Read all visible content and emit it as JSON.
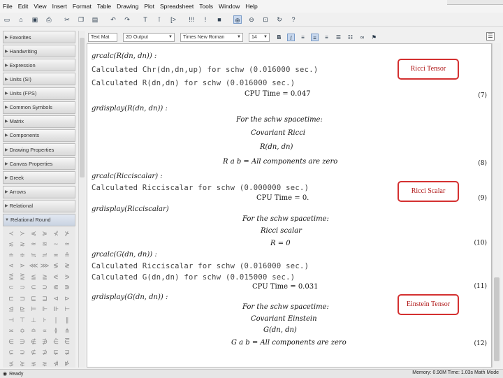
{
  "menu": [
    "File",
    "Edit",
    "View",
    "Insert",
    "Format",
    "Table",
    "Drawing",
    "Plot",
    "Spreadsheet",
    "Tools",
    "Window",
    "Help"
  ],
  "format_bar": {
    "style": "Text Mat",
    "font_size_label": "2D Output",
    "font": "Times New Roman",
    "size": "14",
    "bold": "B",
    "italic": "I"
  },
  "palettes": [
    "Favorites",
    "Handwriting",
    "Expression",
    "Units (SI)",
    "Units (FPS)",
    "Common Symbols",
    "Matrix",
    "Components",
    "Drawing Properties",
    "Canvas Properties",
    "Greek",
    "Arrows",
    "Relational",
    "Relational Round"
  ],
  "document": {
    "in1": "grcalc(R(dn, dn)) :",
    "out1a": "Calculated Chr(dn,dn,up) for schw (0.016000 sec.)",
    "out1b": "Calculated R(dn,dn) for schw (0.016000 sec.)",
    "cpu1": "CPU Time = 0.047",
    "eq7": "(7)",
    "in2": "grdisplay(R(dn, dn)) :",
    "sp1": "For the schw spacetime:",
    "cov_ricci": "Covariant Ricci",
    "r_dn_dn": "R(dn, dn)",
    "all_zero1": "R a b = All components are zero",
    "eq8": "(8)",
    "in3": "grcalc(Ricciscalar) :",
    "out3": "Calculated Ricciscalar for schw (0.000000 sec.)",
    "cpu3": "CPU Time = 0.",
    "eq9": "(9)",
    "in4": "grdisplay(Ricciscalar)",
    "sp2": "For the schw spacetime:",
    "ricci_scalar": "Ricci scalar",
    "r_zero": "R = 0",
    "eq10": "(10)",
    "in5": "grcalc(G(dn, dn)) :",
    "out5a": "Calculated Ricciscalar for schw (0.016000 sec.)",
    "out5b": "Calculated G(dn,dn) for schw (0.015000 sec.)",
    "cpu5": "CPU Time = 0.031",
    "eq11": "(11)",
    "in6": "grdisplay(G(dn, dn)) :",
    "sp3": "For the schw spacetime:",
    "cov_einstein": "Covariant Einstein",
    "g_dn_dn": "G(dn, dn)",
    "all_zero2": "G a b = All components are zero",
    "eq12": "(12)"
  },
  "callouts": {
    "ricci_tensor": "Ricci Tensor",
    "ricci_scalar": "Ricci Scalar",
    "einstein_tensor": "Einstein Tensor"
  },
  "status": {
    "left": "Ready",
    "right": "Memory: 0.90M   Time: 1.03s   Math Mode"
  }
}
